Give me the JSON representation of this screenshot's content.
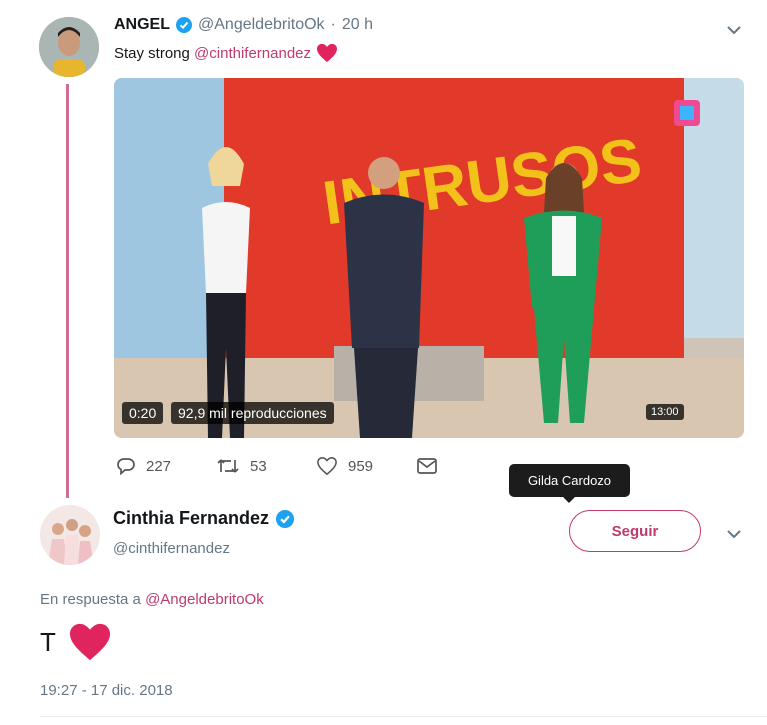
{
  "tweet1": {
    "author_name": "ANGEL",
    "handle": "@AngeldebritoOk",
    "separator": "·",
    "time": "20 h",
    "text_prefix": "Stay strong ",
    "mention": "@cinthifernandez",
    "video": {
      "duration": "0:20",
      "views": "92,9 mil reproducciones",
      "clock": "13:00",
      "overlay_logo_text": "INTRUSOS"
    },
    "actions": {
      "replies": "227",
      "retweets": "53",
      "likes": "959"
    }
  },
  "tooltip": {
    "text": "Gilda Cardozo"
  },
  "tweet2": {
    "author_name": "Cinthia Fernandez",
    "handle": "@cinthifernandez",
    "follow_label": "Seguir",
    "reply_prefix": "En respuesta a ",
    "reply_to": "@AngeldebritoOk",
    "text": "T",
    "timestamp": "19:27 - 17 dic. 2018"
  },
  "colors": {
    "accent": "#c03a6e",
    "verified": "#1da1f2",
    "heart": "#e0245e",
    "thread": "#cf6c9a"
  },
  "icons": [
    "verified-badge-icon",
    "chevron-down-icon",
    "heart-icon",
    "reply-icon",
    "retweet-icon",
    "like-icon",
    "message-icon"
  ]
}
